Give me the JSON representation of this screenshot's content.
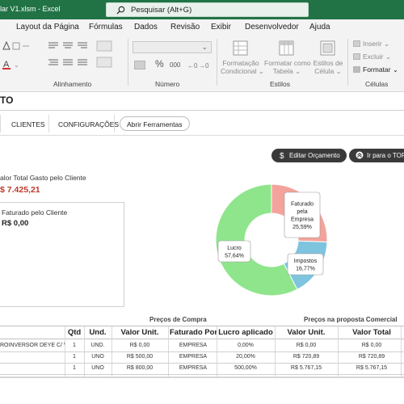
{
  "window": {
    "title": "lar V1.xlsm  -  Excel",
    "search_placeholder": "Pesquisar (Alt+G)"
  },
  "ribbon": {
    "tabs": [
      "Layout da Página",
      "Fórmulas",
      "Dados",
      "Revisão",
      "Exibir",
      "Desenvolvedor",
      "Ajuda"
    ],
    "groups": {
      "alinhamento": "Alinhamento",
      "numero": "Número",
      "estilos": "Estilos",
      "celulas": "Células"
    },
    "estilos_items": {
      "formatacao": [
        "Formatação",
        "Condicional ⌄"
      ],
      "formatar_tabela": [
        "Formatar como",
        "Tabela ⌄"
      ],
      "estilos_celula": [
        "Estilos de",
        "Célula ⌄"
      ]
    },
    "celulas_items": {
      "inserir": "Inserir ⌄",
      "excluir": "Excluir ⌄",
      "formatar": "Formatar ⌄"
    },
    "numero_symbols": {
      "percent": "%",
      "thousands": "000"
    }
  },
  "sheet": {
    "title": "TO",
    "nav": {
      "clientes": "CLIENTES",
      "configuracoes": "CONFIGURAÇÕES",
      "abrir_ferramentas": "Abrir Ferramentas"
    },
    "buttons": {
      "editar": "Editar Orçamento",
      "topo": "Ir para o TOPO"
    },
    "summary": {
      "total_label": "alor Total Gasto pelo Cliente",
      "total_value": "$ 7.425,21",
      "faturado_label": "Faturado pelo Cliente",
      "faturado_value": "R$ 0,00"
    }
  },
  "chart_data": {
    "type": "pie",
    "donut": true,
    "labels": [
      "Faturado pela Empresa",
      "Impostos",
      "Lucro"
    ],
    "values": [
      25.59,
      16.77,
      57.64
    ],
    "label_lines": [
      [
        "Faturado",
        "pela",
        "Empresa",
        "25,59%"
      ],
      [
        "Impostos",
        "16,77%"
      ],
      [
        "Lucro",
        "57,64%"
      ]
    ],
    "colors": [
      "#f3a39b",
      "#7ec4de",
      "#8fe58c"
    ]
  },
  "table": {
    "group_headers": {
      "compra": "Preços de Compra",
      "proposta": "Preços na proposta Comercial"
    },
    "columns": [
      "Qtd",
      "Und.",
      "Valor Unit.",
      "Faturado Por",
      "Lucro aplicado",
      "Valor Unit.",
      "Valor Total"
    ],
    "rows": [
      [
        "ROINVERSOR DEYE C/ WI",
        "1",
        "UND.",
        "R$ 0,00",
        "EMPRESA",
        "0,00%",
        "R$ 0,00",
        "R$ 0,00"
      ],
      [
        "",
        "1",
        "UNO",
        "R$ 500,00",
        "EMPRESA",
        "20,00%",
        "R$ 720,89",
        "R$ 720,89"
      ],
      [
        "",
        "1",
        "UNO",
        "R$ 800,00",
        "EMPRESA",
        "500,00%",
        "R$ 5.767,15",
        "R$ 5.767,15"
      ]
    ]
  }
}
